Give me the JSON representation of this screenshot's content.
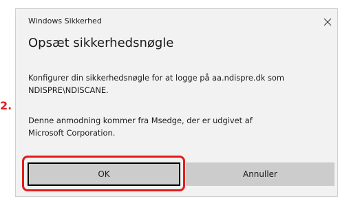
{
  "dialog": {
    "title": "Windows Sikkerhed",
    "heading": "Opsæt sikkerhedsnøgle",
    "message_line1": "Konfigurer din sikkerhedsnøgle for at logge på aa.ndispre.dk som",
    "message_line2": "NDISPRE\\NDISCANE.",
    "message_line3": "Denne anmodning kommer fra Msedge, der er udgivet af",
    "message_line4": "Microsoft Corporation."
  },
  "buttons": {
    "ok_label": "OK",
    "cancel_label": "Annuller"
  },
  "annotation": {
    "step_label": "2.",
    "highlight_color": "#e31b1b"
  },
  "colors": {
    "dialog_bg": "#f2f2f2",
    "button_bg": "#cccccc",
    "text": "#1a1a1a"
  },
  "icons": {
    "close": "close-icon"
  }
}
